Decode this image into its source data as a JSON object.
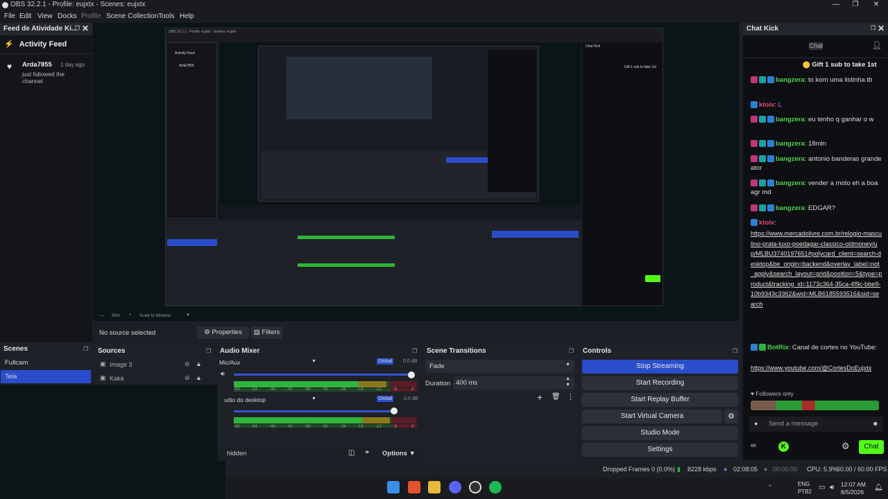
{
  "window": {
    "title": "OBS 32.2.1 - Profile: eujxtx - Scenes: eujxtx"
  },
  "menu": [
    "File",
    "Edit",
    "View",
    "Docks",
    "Profile",
    "Scene Collection",
    "Tools",
    "Help"
  ],
  "activity": {
    "dock_title": "Feed de Atividade Ki...",
    "header": "Activity Feed",
    "item": {
      "user": "Arda7855",
      "time": "1 day ago",
      "text": "just followed the channel"
    }
  },
  "chat": {
    "dock_title": "Chat Kick",
    "tab": "Chat",
    "gift": "Gift 1 sub to take 1st",
    "messages": [
      {
        "user": "bangzera",
        "text": ": to kom uma listinha tb"
      },
      {
        "user": "ktoiv",
        "text": ":"
      },
      {
        "user": "bangzera",
        "text": ": eu tenho q ganhar o w"
      },
      {
        "user": "bangzera",
        "text": ": 18min"
      },
      {
        "user": "bangzera",
        "text": ": antonio banderas grande ator"
      },
      {
        "user": "bangzera",
        "text": ": vender a moto eh a boa agr md"
      },
      {
        "user": "bangzera",
        "text": ": EDGAR?"
      },
      {
        "user": "ktoiv",
        "text": ":"
      }
    ],
    "link1": "https://www.mercadolivre.com.br/relogio-masculino-prata-luxo-poedagar-classico-oldmoney/up/MLBU3740197651#polycard_client=search-desktop&be_origin=backend&overlay_label=not_apply&search_layout=grid&position=5&type=product&tracking_id=1173c364-35ca-4f9c-bbe9-10b9343c3362&wid=MLB6185593516&sid=search",
    "botrix_user": "BotRix",
    "botrix_text": ": Canal de cortes no YouTube:",
    "link2": "https://www.youtube.com/@CortesDoEujxtx",
    "followers_only": "Followers only",
    "input_placeholder": "Send a message",
    "send_label": "Chat"
  },
  "preview": {
    "zoom": "56%",
    "fit": "Scale to Window"
  },
  "source_bar": {
    "status": "No source selected",
    "properties": "Properties",
    "filters": "Filters"
  },
  "scenes": {
    "title": "Scenes",
    "items": [
      "Fullcam",
      "Tela"
    ],
    "selected": 1
  },
  "sources": {
    "title": "Sources",
    "items": [
      "Image 3",
      "Kaká"
    ]
  },
  "mixer": {
    "title": "Audio Mixer",
    "channels": [
      {
        "name": "Mic/Aux",
        "mode": "Global",
        "db": "0.0 dB",
        "level": 1.0
      },
      {
        "name": "udio do desktop",
        "mode": "Global",
        "db": "-2.0 dB",
        "level": 0.87
      }
    ],
    "scale": [
      "-60",
      "-54",
      "-48",
      "-42",
      "-36",
      "-30",
      "-24",
      "-18",
      "-12",
      "-6",
      "0"
    ],
    "hidden": "hidden",
    "options": "Options"
  },
  "transitions": {
    "title": "Scene Transitions",
    "type": "Fade",
    "duration_label": "Duration",
    "duration": "400 ms"
  },
  "controls": {
    "title": "Controls",
    "buttons": [
      "Stop Streaming",
      "Start Recording",
      "Start Replay Buffer",
      "Start Virtual Camera",
      "Studio Mode",
      "Settings"
    ]
  },
  "status": {
    "dropped": "Dropped Frames 0 (0.0%)",
    "kbps": "8228 kbps",
    "stream_time": "02:08:05",
    "rec_time": "00:00:00",
    "cpu": "CPU: 5.9%",
    "fps": "60.00 / 60.00 FPS"
  },
  "taskbar": {
    "lang": "ENG",
    "layout": "PTB2",
    "time": "12:07 AM",
    "date": "8/5/2026"
  },
  "colors": {
    "accent": "#2a4dcc",
    "kick_green": "#53fc18",
    "bg": "#1d1f26"
  }
}
